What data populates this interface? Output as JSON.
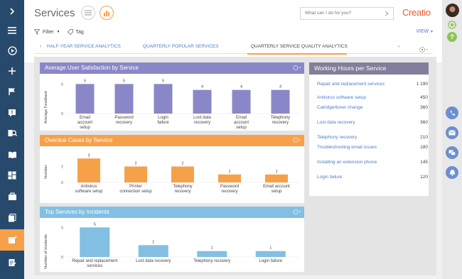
{
  "app": {
    "title": "Services",
    "logo": "Creatio"
  },
  "search": {
    "placeholder": "What can I do for you?"
  },
  "toolbar": {
    "filter_label": "Filter",
    "tag_label": "Tag",
    "view_label": "VIEW"
  },
  "tabs": [
    {
      "label": "HALF-YEAR SERVICE ANALYTICS"
    },
    {
      "label": "QUARTERLY POPULAR SERVICES"
    },
    {
      "label": "QUARTERLY SERVICE QUALITY ANALYTICS",
      "active": true
    }
  ],
  "colors": {
    "sidebar": "#274a6c",
    "accent": "#f6a14a",
    "purple": "#8a87c8",
    "sky": "#82bfe3",
    "link": "#4b7dc9",
    "logo": "#ea5a2a"
  },
  "panels": {
    "satisfaction": {
      "title": "Average User Satisfaction by Service",
      "ylabel": "Average Feedback"
    },
    "overdue": {
      "title": "Overdue Cases by Service",
      "ylabel": "Number"
    },
    "top": {
      "title": "Top Services by Incidents",
      "ylabel": "Number of incidents"
    },
    "hours": {
      "title": "Working Hours per Service"
    }
  },
  "hours_rows": [
    {
      "name": "Repair and replacement services",
      "value": "1 190"
    },
    {
      "name": "Antivirus software setup",
      "value": "450"
    },
    {
      "name": "Catridge/toner change",
      "value": "360"
    },
    {
      "name": "Lost data recovery",
      "value": "360"
    },
    {
      "name": "Telephony recovery",
      "value": "210"
    },
    {
      "name": "Troubleshooting email issues",
      "value": "180"
    },
    {
      "name": "Installing an extension phone",
      "value": "145"
    },
    {
      "name": "Login failure",
      "value": "120"
    }
  ],
  "chart_data": [
    {
      "type": "bar",
      "title": "Average User Satisfaction by Service",
      "ylabel": "Average Feedback",
      "categories": [
        "Email account setup",
        "Password recovery",
        "Login failure",
        "Lost data recovery",
        "Email account setup",
        "Telephony recovery"
      ],
      "values": [
        5,
        5,
        5,
        4,
        4,
        4
      ],
      "ylim": [
        0,
        6
      ],
      "yticks": [
        0,
        5
      ],
      "color": "#8a87c8"
    },
    {
      "type": "bar",
      "title": "Overdue Cases by Service",
      "ylabel": "Number",
      "categories": [
        "Antivirus software setup",
        "Printer connection setup",
        "Telephony recovery",
        "Password recovery",
        "Email account setup"
      ],
      "values": [
        3,
        2,
        2,
        1,
        1
      ],
      "ylim": [
        0,
        4
      ],
      "yticks": [
        0,
        2
      ],
      "color": "#f6a14a"
    },
    {
      "type": "bar",
      "title": "Top Services by Incidents",
      "ylabel": "Number of incidents",
      "categories": [
        "Repair and replacement services",
        "Lost data recovery",
        "Telephony recovery",
        "Login failure"
      ],
      "values": [
        5,
        2,
        1,
        1
      ],
      "ylim": [
        0,
        6
      ],
      "yticks": [
        0,
        5
      ],
      "color": "#82bfe3"
    }
  ]
}
